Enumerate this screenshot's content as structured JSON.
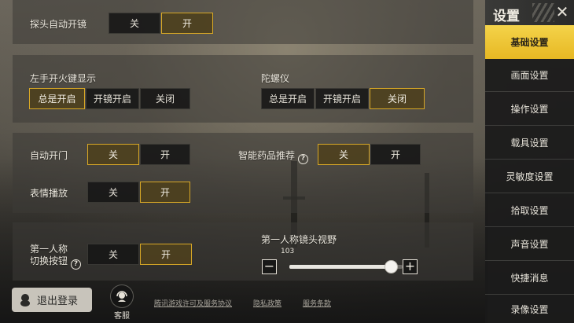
{
  "settings": {
    "peek_scope": {
      "label": "探头自动开镜",
      "options": [
        "关",
        "开"
      ],
      "selected": 1
    },
    "left_fire": {
      "label": "左手开火键显示",
      "options": [
        "总是开启",
        "开镜开启",
        "关闭"
      ],
      "selected": 0
    },
    "gyro": {
      "label": "陀螺仪",
      "options": [
        "总是开启",
        "开镜开启",
        "关闭"
      ],
      "selected": 2
    },
    "auto_door": {
      "label": "自动开门",
      "options": [
        "关",
        "开"
      ],
      "selected": 0
    },
    "smart_meds": {
      "label": "智能药品推荐",
      "help": "?",
      "options": [
        "关",
        "开"
      ],
      "selected": 0
    },
    "emote": {
      "label": "表情播放",
      "options": [
        "关",
        "开"
      ],
      "selected": 1
    },
    "fpp_switch": {
      "label_line1": "第一人称",
      "label_line2": "切换按钮",
      "help": "?",
      "options": [
        "关",
        "开"
      ],
      "selected": 1
    },
    "fpp_fov": {
      "label": "第一人称镜头视野",
      "value": "103",
      "fraction": 0.9,
      "minus": "−",
      "plus": "+"
    }
  },
  "sidebar": {
    "title": "设置",
    "close": "✕",
    "items": [
      {
        "label": "基础设置",
        "active": true
      },
      {
        "label": "画面设置",
        "active": false
      },
      {
        "label": "操作设置",
        "active": false
      },
      {
        "label": "载具设置",
        "active": false
      },
      {
        "label": "灵敏度设置",
        "active": false
      },
      {
        "label": "拾取设置",
        "active": false
      },
      {
        "label": "声音设置",
        "active": false
      },
      {
        "label": "快捷消息",
        "active": false
      },
      {
        "label": "录像设置",
        "active": false
      }
    ]
  },
  "footer": {
    "logout": "退出登录",
    "service": "客服",
    "links": [
      "腾讯游戏许可及服务协议",
      "隐私政策",
      "服务条款"
    ]
  }
}
